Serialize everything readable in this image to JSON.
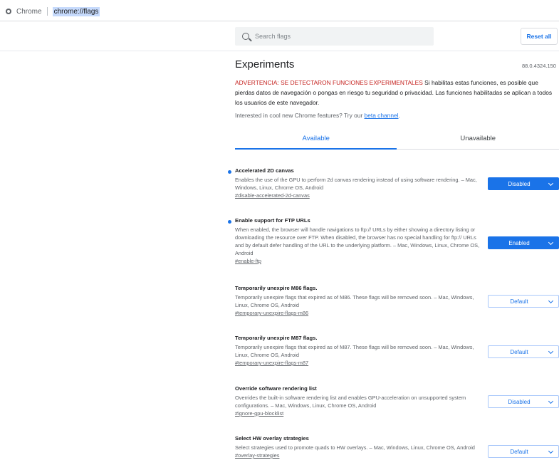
{
  "omnibox": {
    "site_label": "Chrome",
    "url": "chrome://flags"
  },
  "search": {
    "placeholder": "Search flags"
  },
  "header": {
    "reset_label": "Reset all"
  },
  "page": {
    "title": "Experiments",
    "version": "88.0.4324.150",
    "warning_red": "ADVERTENCIA: SE DETECTARON FUNCIONES EXPERIMENTALES",
    "warning_text": " Si habilitas estas funciones, es posible que pierdas datos de navegación o pongas en riesgo tu seguridad o privacidad. Las funciones habilitadas se aplican a todos los usuarios de este navegador.",
    "cool_prefix": "Interested in cool new Chrome features? Try our ",
    "cool_link": "beta channel",
    "cool_suffix": "."
  },
  "tabs": [
    {
      "label": "Available"
    },
    {
      "label": "Unavailable"
    }
  ],
  "experiments": [
    {
      "title": "Accelerated 2D canvas",
      "description": "Enables the use of the GPU to perform 2d canvas rendering instead of using software rendering. – Mac, Windows, Linux, Chrome OS, Android",
      "link": "#disable-accelerated-2d-canvas",
      "value": "Disabled"
    },
    {
      "title": "Enable support for FTP URLs",
      "description": "When enabled, the browser will handle navigations to ftp:// URLs by either showing a directory listing or downloading the resource over FTP. When disabled, the browser has no special handling for ftp:// URLs and by default defer handling of the URL to the underlying platform. – Mac, Windows, Linux, Chrome OS, Android",
      "link": "#enable-ftp",
      "value": "Enabled"
    },
    {
      "title": "Temporarily unexpire M86 flags.",
      "description": "Temporarily unexpire flags that expired as of M86. These flags will be removed soon. – Mac, Windows, Linux, Chrome OS, Android",
      "link": "#temporary-unexpire-flags-m86",
      "value": "Default"
    },
    {
      "title": "Temporarily unexpire M87 flags.",
      "description": "Temporarily unexpire flags that expired as of M87. These flags will be removed soon. – Mac, Windows, Linux, Chrome OS, Android",
      "link": "#temporary-unexpire-flags-m87",
      "value": "Default"
    },
    {
      "title": "Override software rendering list",
      "description": "Overrides the built-in software rendering list and enables GPU-acceleration on unsupported system configurations. – Mac, Windows, Linux, Chrome OS, Android",
      "link": "#ignore-gpu-blocklist",
      "value": "Disabled"
    },
    {
      "title": "Select HW overlay strategies",
      "description": "Select strategies used to promote quads to HW overlays. – Mac, Windows, Linux, Chrome OS, Android",
      "link": "#overlay-strategies",
      "value": "Default"
    }
  ]
}
